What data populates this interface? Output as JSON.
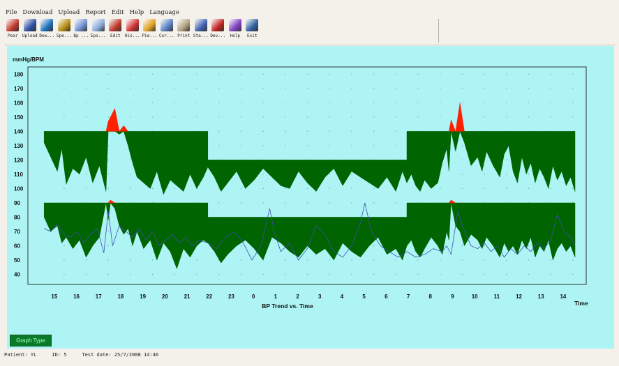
{
  "menu": [
    "File",
    "Download",
    "Upload",
    "Report",
    "Edit",
    "Help",
    "Language"
  ],
  "toolbar": [
    {
      "label": "Pear",
      "icon": "patient-icon",
      "color": "#c0392b"
    },
    {
      "label": "Upload",
      "icon": "upload-icon",
      "color": "#2e4fa0"
    },
    {
      "label": "Dow...",
      "icon": "download-icon",
      "color": "#1d6fb8"
    },
    {
      "label": "Spe...",
      "icon": "spectrum-icon",
      "color": "#b58c12"
    },
    {
      "label": "Bp ...",
      "icon": "bp-chart-icon",
      "color": "#6b8fd0"
    },
    {
      "label": "Epo...",
      "icon": "episode-icon",
      "color": "#8aa9d8"
    },
    {
      "label": "Edit",
      "icon": "edit-icon",
      "color": "#c0392b"
    },
    {
      "label": "His...",
      "icon": "histogram-icon",
      "color": "#d03030"
    },
    {
      "label": "Pie...",
      "icon": "pie-icon",
      "color": "#e0a020"
    },
    {
      "label": "Cor...",
      "icon": "correlation-icon",
      "color": "#5a7fc0"
    },
    {
      "label": "Print",
      "icon": "printer-icon",
      "color": "#b0a080"
    },
    {
      "label": "Sta...",
      "icon": "statistics-icon",
      "color": "#4060b0"
    },
    {
      "label": "Dev...",
      "icon": "device-icon",
      "color": "#c02020"
    },
    {
      "label": "Help",
      "icon": "help-icon",
      "color": "#8040c0"
    },
    {
      "label": "Exit",
      "icon": "exit-icon",
      "color": "#3060a0"
    }
  ],
  "graph_type_label": "Graph Type",
  "status": {
    "patient": "Patient: YL",
    "id": "ID: 5",
    "test_date": "Test date: 25/7/2008 14:40"
  },
  "colors": {
    "background": "#aef4f4",
    "fill": "#006400",
    "exceed": "#ff2000",
    "heart_rate": "#3a4fb0"
  },
  "chart_data": {
    "type": "area",
    "ylabel": "mmHg/BPM",
    "xlabel": "BP Trend vs. Time",
    "x_axis_label": "Time",
    "yticks": [
      40,
      50,
      60,
      70,
      80,
      90,
      100,
      110,
      120,
      130,
      140,
      150,
      160,
      170,
      180
    ],
    "ylim": [
      33,
      185
    ],
    "xticks": [
      "15",
      "16",
      "17",
      "18",
      "19",
      "20",
      "21",
      "22",
      "23",
      "0",
      "1",
      "2",
      "3",
      "4",
      "5",
      "6",
      "7",
      "8",
      "9",
      "10",
      "11",
      "12",
      "13",
      "14"
    ],
    "grid": "dotted",
    "thresholds": {
      "systolic_day": 140,
      "systolic_night": 120,
      "diastolic_day": 90,
      "diastolic_night": 80,
      "night_start": "22",
      "night_end": "7"
    },
    "series": [
      {
        "name": "systolic",
        "x": [
          14.6,
          14.9,
          15.2,
          15.4,
          15.6,
          15.9,
          16.2,
          16.5,
          16.8,
          17.1,
          17.4,
          17.5,
          17.6,
          17.8,
          18.0,
          18.2,
          18.4,
          18.6,
          18.8,
          19.1,
          19.4,
          19.7,
          20.0,
          20.3,
          20.6,
          20.9,
          21.2,
          21.5,
          21.8,
          22.0,
          22.3,
          22.6,
          22.9,
          23.3,
          23.7,
          24.1,
          24.5,
          24.9,
          25.3,
          25.7,
          26.1,
          26.5,
          26.9,
          27.3,
          27.7,
          28.1,
          28.5,
          28.9,
          29.3,
          29.7,
          30.1,
          30.5,
          30.8,
          31.0,
          31.2,
          31.4,
          31.6,
          31.8,
          32.1,
          32.4,
          32.6,
          32.8,
          32.9,
          33.0,
          33.2,
          33.4,
          33.6,
          33.9,
          34.2,
          34.4,
          34.6,
          34.9,
          35.2,
          35.4,
          35.6,
          35.8,
          36.0,
          36.2,
          36.4,
          36.6,
          36.8,
          37.0,
          37.2,
          37.4,
          37.6,
          37.8,
          38.0,
          38.2,
          38.4,
          38.6
        ],
        "values": [
          132,
          122,
          112,
          128,
          103,
          114,
          110,
          122,
          104,
          116,
          98,
          147,
          150,
          156,
          138,
          144,
          130,
          118,
          108,
          104,
          100,
          112,
          96,
          106,
          102,
          98,
          110,
          100,
          108,
          115,
          108,
          98,
          104,
          112,
          100,
          106,
          114,
          108,
          102,
          100,
          112,
          104,
          98,
          108,
          114,
          102,
          112,
          108,
          104,
          100,
          108,
          98,
          112,
          104,
          110,
          102,
          98,
          106,
          100,
          104,
          118,
          128,
          112,
          148,
          126,
          160,
          132,
          116,
          122,
          112,
          126,
          116,
          108,
          124,
          130,
          112,
          104,
          122,
          110,
          118,
          104,
          114,
          108,
          100,
          116,
          106,
          112,
          102,
          108,
          98
        ]
      },
      {
        "name": "diastolic",
        "x": [
          14.6,
          14.9,
          15.2,
          15.4,
          15.6,
          15.9,
          16.2,
          16.5,
          16.8,
          17.1,
          17.4,
          17.5,
          17.6,
          17.8,
          18.0,
          18.2,
          18.4,
          18.6,
          18.8,
          19.1,
          19.4,
          19.7,
          20.0,
          20.3,
          20.6,
          20.9,
          21.2,
          21.5,
          21.8,
          22.0,
          22.3,
          22.6,
          22.9,
          23.3,
          23.7,
          24.1,
          24.5,
          24.9,
          25.3,
          25.7,
          26.1,
          26.5,
          26.9,
          27.3,
          27.7,
          28.1,
          28.5,
          28.9,
          29.3,
          29.7,
          30.1,
          30.5,
          30.8,
          31.0,
          31.2,
          31.4,
          31.6,
          31.8,
          32.1,
          32.4,
          32.6,
          32.8,
          32.9,
          33.0,
          33.2,
          33.4,
          33.6,
          33.9,
          34.2,
          34.4,
          34.6,
          34.9,
          35.2,
          35.4,
          35.6,
          35.8,
          36.0,
          36.2,
          36.4,
          36.6,
          36.8,
          37.0,
          37.2,
          37.4,
          37.6,
          37.8,
          38.0,
          38.2,
          38.4,
          38.6
        ],
        "values": [
          80,
          70,
          74,
          62,
          66,
          58,
          64,
          52,
          60,
          66,
          90,
          78,
          92,
          86,
          74,
          68,
          72,
          60,
          70,
          58,
          64,
          50,
          62,
          56,
          44,
          58,
          52,
          60,
          64,
          62,
          56,
          48,
          54,
          60,
          64,
          58,
          50,
          66,
          62,
          56,
          52,
          60,
          54,
          58,
          50,
          62,
          56,
          52,
          60,
          66,
          54,
          58,
          50,
          60,
          64,
          56,
          52,
          58,
          66,
          60,
          54,
          70,
          64,
          92,
          74,
          70,
          60,
          68,
          64,
          58,
          66,
          60,
          52,
          62,
          56,
          60,
          54,
          64,
          58,
          66,
          52,
          60,
          56,
          64,
          50,
          58,
          62,
          56,
          60,
          52
        ]
      },
      {
        "name": "heart rate",
        "x": [
          14.6,
          14.9,
          15.2,
          15.5,
          15.8,
          16.1,
          16.4,
          16.7,
          17.0,
          17.3,
          17.5,
          17.7,
          18.0,
          18.3,
          18.6,
          18.9,
          19.2,
          19.5,
          19.8,
          20.1,
          20.4,
          20.7,
          21.0,
          21.3,
          21.6,
          22.0,
          22.4,
          22.8,
          23.2,
          23.6,
          24.0,
          24.4,
          24.8,
          25.0,
          25.3,
          25.7,
          26.1,
          26.5,
          26.9,
          27.3,
          27.7,
          28.1,
          28.5,
          28.9,
          29.1,
          29.4,
          29.8,
          30.2,
          30.6,
          31.0,
          31.4,
          31.8,
          32.2,
          32.6,
          32.8,
          33.0,
          33.3,
          33.6,
          33.9,
          34.2,
          34.5,
          34.8,
          35.1,
          35.4,
          35.7,
          36.0,
          36.3,
          36.6,
          36.9,
          37.2,
          37.5,
          37.8,
          38.1,
          38.4,
          38.6
        ],
        "values": [
          72,
          70,
          75,
          68,
          66,
          70,
          62,
          68,
          72,
          55,
          84,
          60,
          74,
          70,
          66,
          72,
          64,
          70,
          60,
          64,
          68,
          62,
          66,
          60,
          64,
          62,
          58,
          66,
          70,
          62,
          50,
          60,
          86,
          70,
          56,
          62,
          50,
          58,
          74,
          68,
          56,
          52,
          60,
          76,
          90,
          70,
          60,
          56,
          52,
          56,
          52,
          54,
          58,
          56,
          60,
          54,
          84,
          70,
          60,
          58,
          62,
          56,
          60,
          52,
          58,
          54,
          60,
          56,
          62,
          58,
          64,
          82,
          70,
          66,
          60
        ]
      }
    ]
  }
}
